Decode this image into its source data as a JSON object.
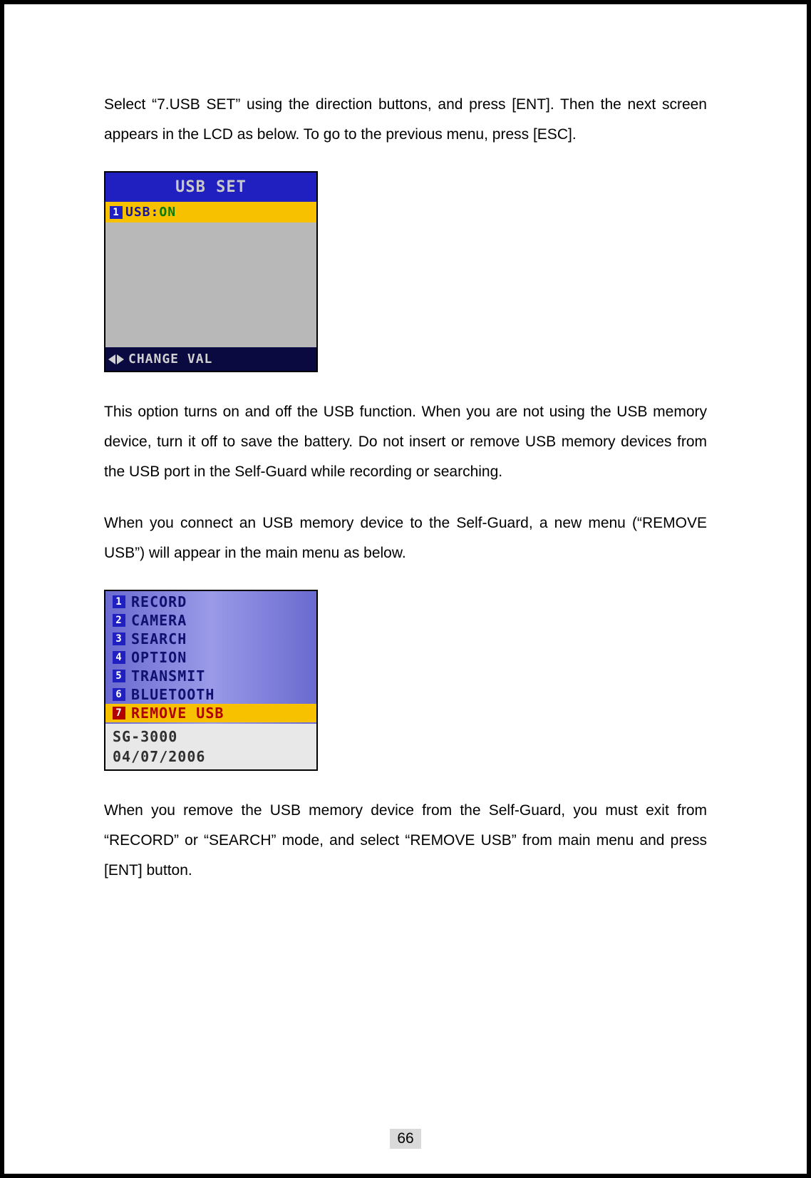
{
  "para1": "Select “7.USB SET” using the direction buttons, and press [ENT]. Then the next screen appears in the LCD as below. To go to the previous menu, press [ESC].",
  "lcd1": {
    "title": "USB SET",
    "item_num": "1",
    "item_label": "USB:",
    "item_value": "ON",
    "footer": "CHANGE VAL"
  },
  "para2": "This option turns on and off the USB function. When you are not using the USB memory device, turn it off to save the battery. Do not insert or remove USB memory devices from the USB port in the Self-Guard while recording or searching.",
  "para3": "When you connect an USB memory device to the Self-Guard, a new menu (“REMOVE USB”) will appear in the main menu as below.",
  "lcd2": {
    "items": [
      {
        "num": "1",
        "label": "RECORD",
        "selected": false
      },
      {
        "num": "2",
        "label": "CAMERA",
        "selected": false
      },
      {
        "num": "3",
        "label": "SEARCH",
        "selected": false
      },
      {
        "num": "4",
        "label": "OPTION",
        "selected": false
      },
      {
        "num": "5",
        "label": "TRANSMIT",
        "selected": false
      },
      {
        "num": "6",
        "label": "BLUETOOTH",
        "selected": false
      },
      {
        "num": "7",
        "label": "REMOVE USB",
        "selected": true
      }
    ],
    "model": "SG-3000",
    "date": "04/07/2006"
  },
  "para4": "When you remove the USB memory device from the Self-Guard, you must exit from “RECORD” or “SEARCH” mode, and select “REMOVE USB” from main menu and press [ENT] button.",
  "pageNumber": "66"
}
